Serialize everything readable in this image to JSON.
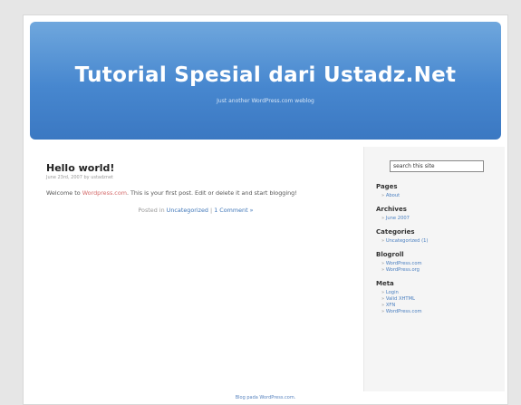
{
  "header": {
    "title": "Tutorial Spesial dari Ustadz.Net",
    "description": "Just another WordPress.com weblog"
  },
  "post": {
    "title": "Hello world!",
    "meta": "June 23rd, 2007 by ustadznet",
    "body_before": "Welcome to ",
    "body_link": "Wordpress.com",
    "body_after": ". This is your first post. Edit or delete it and start blogging!",
    "footer_prefix": "Posted in ",
    "category_link": "Uncategorized",
    "separator": " | ",
    "comments_link": "1 Comment »"
  },
  "sidebar": {
    "search_value": "search this site",
    "widgets": [
      {
        "title": "Pages",
        "items": [
          "About"
        ]
      },
      {
        "title": "Archives",
        "items": [
          "June 2007"
        ]
      },
      {
        "title": "Categories",
        "items": [
          "Uncategorized (1)"
        ]
      },
      {
        "title": "Blogroll",
        "items": [
          "WordPress.com",
          "WordPress.org"
        ]
      },
      {
        "title": "Meta",
        "items": [
          "Login",
          "Valid XHTML",
          "XFN",
          "WordPress.com"
        ]
      }
    ]
  },
  "footer": {
    "text": "Blog pada WordPress.com."
  }
}
